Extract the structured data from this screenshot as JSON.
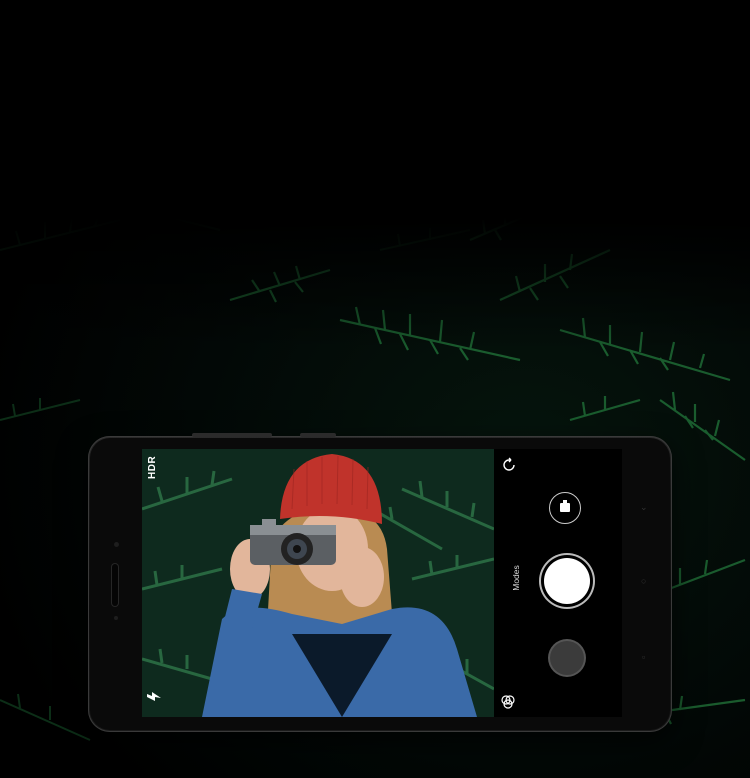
{
  "camera": {
    "hdr_label": "HDR",
    "modes_label": "Modes"
  },
  "icons": {
    "flash": "flash-auto-icon",
    "switch_camera": "rotate-camera-icon",
    "video": "video-camera-icon",
    "filters": "filters-icon",
    "shutter": "shutter-button",
    "gallery": "gallery-thumbnail"
  },
  "colors": {
    "background": "#000000",
    "foliage": "#1f6b36",
    "phone_body": "#151515",
    "hat": "#c0332b",
    "jacket": "#3a6aa8"
  }
}
